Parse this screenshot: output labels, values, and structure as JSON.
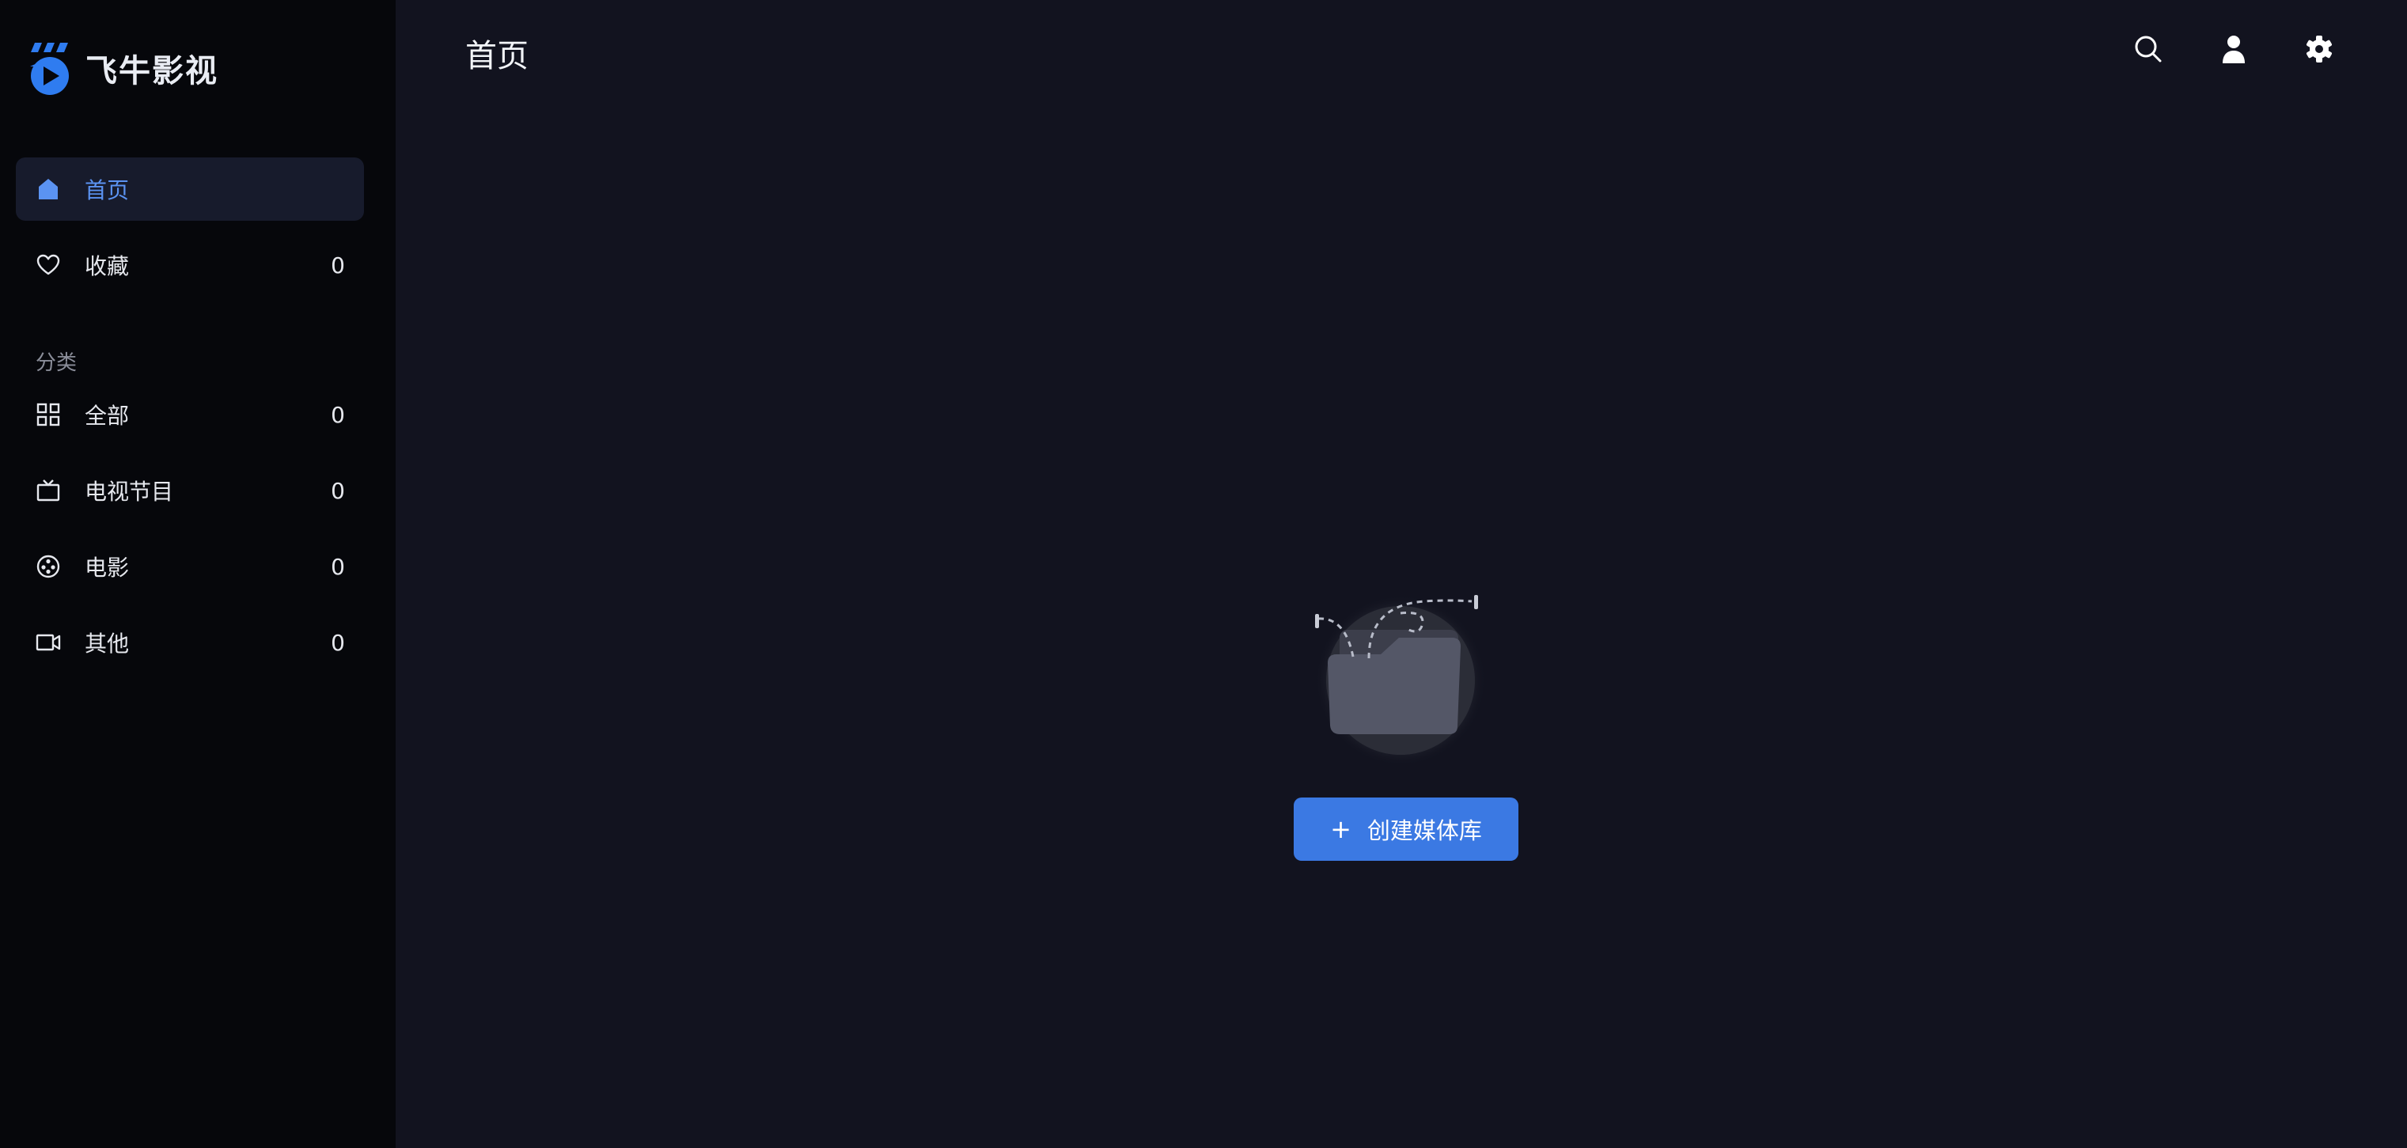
{
  "app": {
    "name": "飞牛影视",
    "accent_color": "#3b79e3",
    "logo_icon": "play-logo-icon"
  },
  "sidebar": {
    "main_items": [
      {
        "label": "首页",
        "icon": "home-icon",
        "active": true
      },
      {
        "label": "收藏",
        "icon": "heart-icon",
        "count": "0"
      }
    ],
    "category_title": "分类",
    "category_items": [
      {
        "label": "全部",
        "icon": "grid-icon",
        "count": "0"
      },
      {
        "label": "电视节目",
        "icon": "tv-icon",
        "count": "0"
      },
      {
        "label": "电影",
        "icon": "film-reel-icon",
        "count": "0"
      },
      {
        "label": "其他",
        "icon": "video-camera-icon",
        "count": "0"
      }
    ]
  },
  "header": {
    "title": "首页",
    "actions": [
      {
        "icon": "search-icon"
      },
      {
        "icon": "user-icon"
      },
      {
        "icon": "gear-icon"
      }
    ]
  },
  "empty_state": {
    "illustration": "empty-folder-icon",
    "button_icon": "+",
    "button_label": "创建媒体库"
  }
}
